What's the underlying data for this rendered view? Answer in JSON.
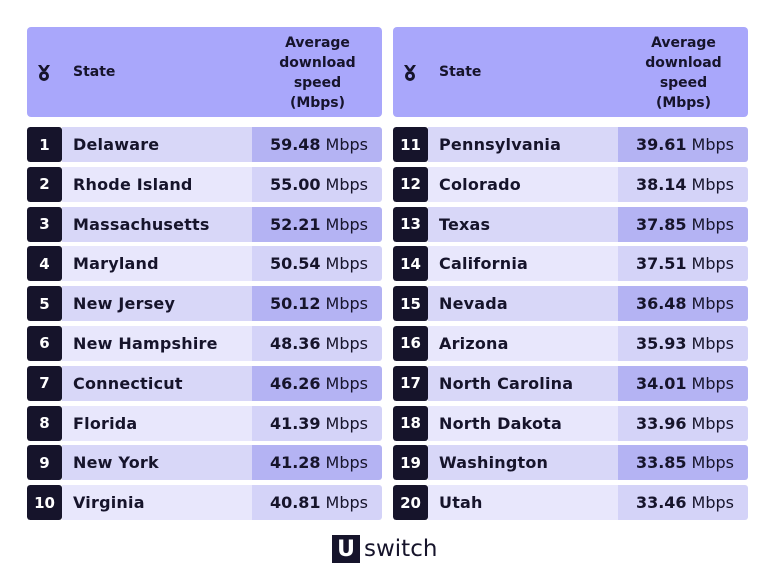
{
  "header": {
    "rank_icon": "medal-icon",
    "state_label": "State",
    "speed_label_lines": [
      "Average",
      "download",
      "speed",
      "(Mbps)"
    ]
  },
  "unit": "Mbps",
  "rows": [
    {
      "rank": "1",
      "state": "Delaware",
      "speed": "59.48"
    },
    {
      "rank": "2",
      "state": "Rhode Island",
      "speed": "55.00"
    },
    {
      "rank": "3",
      "state": "Massachusetts",
      "speed": "52.21"
    },
    {
      "rank": "4",
      "state": "Maryland",
      "speed": "50.54"
    },
    {
      "rank": "5",
      "state": "New Jersey",
      "speed": "50.12"
    },
    {
      "rank": "6",
      "state": "New Hampshire",
      "speed": "48.36"
    },
    {
      "rank": "7",
      "state": "Connecticut",
      "speed": "46.26"
    },
    {
      "rank": "8",
      "state": "Florida",
      "speed": "41.39"
    },
    {
      "rank": "9",
      "state": "New York",
      "speed": "41.28"
    },
    {
      "rank": "10",
      "state": "Virginia",
      "speed": "40.81"
    },
    {
      "rank": "11",
      "state": "Pennsylvania",
      "speed": "39.61"
    },
    {
      "rank": "12",
      "state": "Colorado",
      "speed": "38.14"
    },
    {
      "rank": "13",
      "state": "Texas",
      "speed": "37.85"
    },
    {
      "rank": "14",
      "state": "California",
      "speed": "37.51"
    },
    {
      "rank": "15",
      "state": "Nevada",
      "speed": "36.48"
    },
    {
      "rank": "16",
      "state": "Arizona",
      "speed": "35.93"
    },
    {
      "rank": "17",
      "state": "North Carolina",
      "speed": "34.01"
    },
    {
      "rank": "18",
      "state": "North Dakota",
      "speed": "33.96"
    },
    {
      "rank": "19",
      "state": "Washington",
      "speed": "33.85"
    },
    {
      "rank": "20",
      "state": "Utah",
      "speed": "33.46"
    }
  ],
  "logo": {
    "mark": "U",
    "word": "switch"
  },
  "colors": {
    "header_bg": "#a9a7fb",
    "rank_bg": "#16142b",
    "row_odd_name": "#d8d7f8",
    "row_odd_speed": "#b4b3f3",
    "row_even_name": "#e8e7fc",
    "row_even_speed": "#d4d3f8"
  }
}
